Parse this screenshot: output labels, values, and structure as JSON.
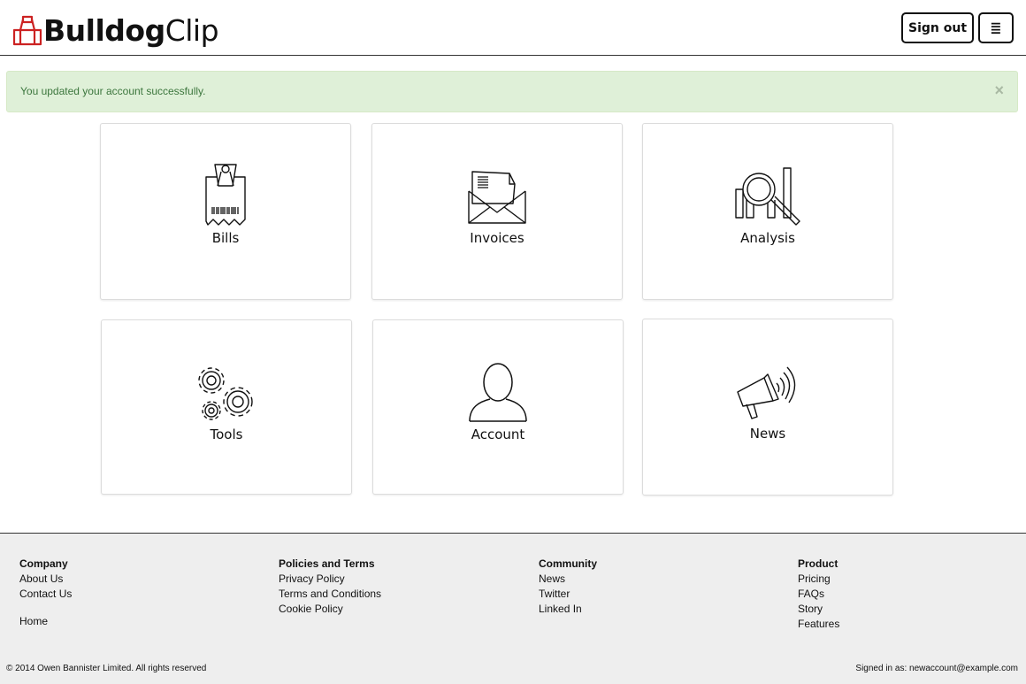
{
  "header": {
    "logo_bold": "Bulldog",
    "logo_light": "Clip",
    "signout_label": "Sign out",
    "menu_icon": "≣"
  },
  "alert": {
    "message": "You updated your account successfully.",
    "close": "×"
  },
  "tiles": [
    {
      "label": "Bills",
      "icon": "receipt-clip-icon"
    },
    {
      "label": "Invoices",
      "icon": "envelope-icon"
    },
    {
      "label": "Analysis",
      "icon": "magnifier-chart-icon"
    },
    {
      "label": "Tools",
      "icon": "gears-icon"
    },
    {
      "label": "Account",
      "icon": "person-icon"
    },
    {
      "label": "News",
      "icon": "megaphone-icon"
    }
  ],
  "footer": {
    "columns": [
      {
        "heading": "Company",
        "links": [
          "About Us",
          "Contact Us"
        ]
      },
      {
        "heading": "Policies and Terms",
        "links": [
          "Privacy Policy",
          "Terms and Conditions",
          "Cookie Policy"
        ]
      },
      {
        "heading": "Community",
        "links": [
          "News",
          "Twitter",
          "Linked In"
        ]
      },
      {
        "heading": "Product",
        "links": [
          "Pricing",
          "FAQs",
          "Story",
          "Features"
        ]
      }
    ],
    "home": "Home",
    "copyright": "© 2014 Owen Bannister Limited. All rights reserved",
    "signed_in": "Signed in as: newaccount@example.com"
  },
  "colors": {
    "brand_red": "#cc2222",
    "alert_bg": "#dff0d8",
    "alert_text": "#3c763d",
    "footer_bg": "#eeeeee"
  }
}
